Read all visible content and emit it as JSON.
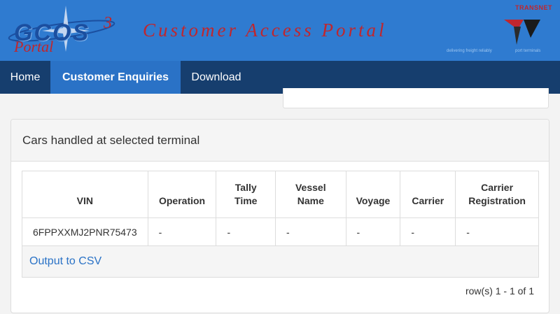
{
  "header": {
    "logo_text": "GCOS",
    "logo_superscript": "3",
    "logo_subtext": "Portal",
    "title": "Customer Access Portal",
    "brand_name": "TRANSNET",
    "brand_tagline": "delivering freight reliably",
    "brand_division": "port terminals"
  },
  "nav": {
    "items": [
      {
        "label": "Home",
        "active": false
      },
      {
        "label": "Customer Enquiries",
        "active": true
      },
      {
        "label": "Download",
        "active": false
      }
    ]
  },
  "panel": {
    "title": "Cars handled at selected terminal"
  },
  "table": {
    "columns": [
      "VIN",
      "Operation",
      "Tally\nTime",
      "Vessel\nName",
      "Voyage",
      "Carrier",
      "Carrier\nRegistration"
    ],
    "rows": [
      [
        "6FPPXXMJ2PNR75473",
        "-",
        "-",
        "-",
        "-",
        "-",
        "-"
      ]
    ]
  },
  "footer": {
    "csv_link": "Output to CSV",
    "row_count": "row(s) 1 - 1 of 1"
  },
  "colors": {
    "banner": "#2f7bd0",
    "navbar": "#163e6e",
    "nav_active": "#2a72c6",
    "title_red": "#c0262d",
    "link": "#2a72c6"
  }
}
